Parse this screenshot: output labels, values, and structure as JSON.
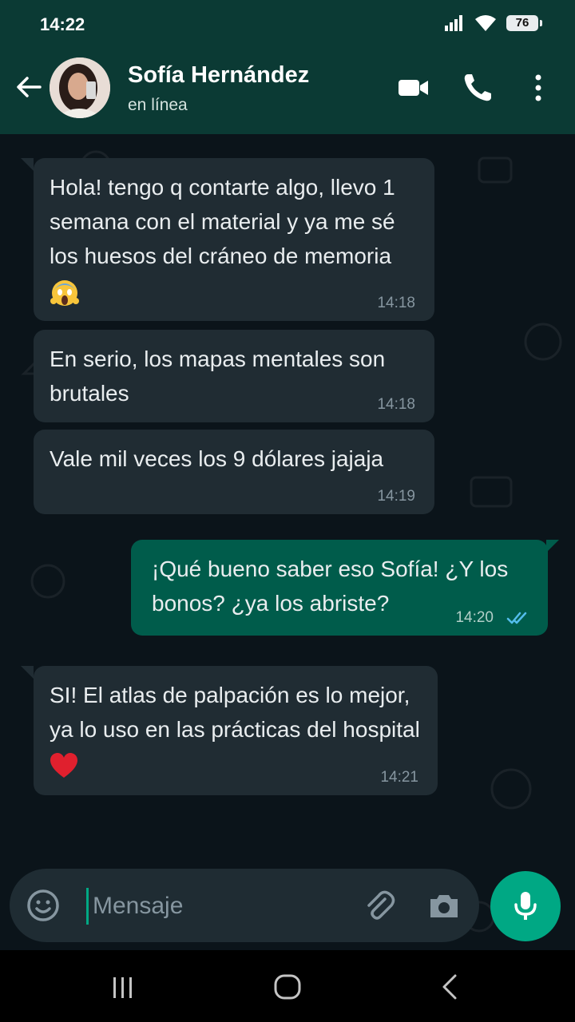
{
  "status_bar": {
    "time": "14:22",
    "battery": "76"
  },
  "header": {
    "name": "Sofía Hernández",
    "status": "en línea"
  },
  "messages": [
    {
      "direction": "in",
      "text": "Hola! tengo q contarte algo, llevo 1 semana con el material y ya me sé los huesos del cráneo de memoria",
      "emoji": "scream-emoji",
      "time": "14:18"
    },
    {
      "direction": "in",
      "text": "En serio, los mapas mentales son brutales",
      "time": "14:18"
    },
    {
      "direction": "in",
      "text": "Vale mil veces los 9 dólares jajaja",
      "time": "14:19"
    },
    {
      "direction": "out",
      "text": "¡Qué bueno saber eso Sofía! ¿Y los bonos? ¿ya los abriste?",
      "time": "14:20",
      "ticks": "double-check-read"
    },
    {
      "direction": "in",
      "text": "SI! El atlas de palpación es lo mejor, ya lo uso en las prácticas del hospital",
      "emoji": "red-heart-emoji",
      "time": "14:21"
    }
  ],
  "composer": {
    "placeholder": "Mensaje"
  },
  "colors": {
    "header_bg": "#0b3a34",
    "chat_bg": "#0b141a",
    "incoming_bubble": "#202c33",
    "outgoing_bubble": "#005c4b",
    "accent": "#00a884",
    "read_ticks": "#53bdeb"
  }
}
